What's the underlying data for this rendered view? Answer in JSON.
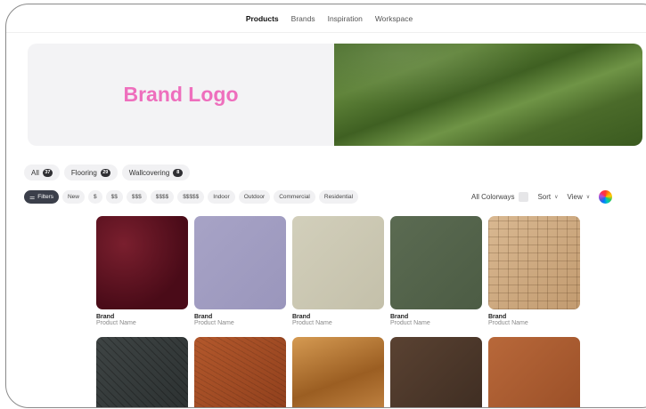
{
  "nav": {
    "items": [
      {
        "label": "Products",
        "active": true
      },
      {
        "label": "Brands",
        "active": false
      },
      {
        "label": "Inspiration",
        "active": false
      },
      {
        "label": "Workspace",
        "active": false
      }
    ]
  },
  "hero": {
    "logo_text": "Brand Logo",
    "logo_color": "#ee6fbd",
    "image_color": "#4f7330"
  },
  "categories": [
    {
      "label": "All",
      "count": "37"
    },
    {
      "label": "Flooring",
      "count": "29"
    },
    {
      "label": "Wallcovering",
      "count": "8"
    }
  ],
  "filters": {
    "filters_label": "Filters",
    "chips": [
      "New",
      "$",
      "$$",
      "$$$",
      "$$$$",
      "$$$$$",
      "Indoor",
      "Outdoor",
      "Commercial",
      "Residential"
    ]
  },
  "controls": {
    "colorways_label": "All Colorways",
    "sort_label": "Sort",
    "view_label": "View"
  },
  "products": [
    {
      "brand": "Brand",
      "name": "Product Name",
      "color": "#5a1220"
    },
    {
      "brand": "Brand",
      "name": "Product Name",
      "color": "#a19dc1"
    },
    {
      "brand": "Brand",
      "name": "Product Name",
      "color": "#cbc7b2"
    },
    {
      "brand": "Brand",
      "name": "Product Name",
      "color": "#56654c"
    },
    {
      "brand": "Brand",
      "name": "Product Name",
      "color": "#cfab80"
    },
    {
      "brand": "",
      "name": "",
      "color": "#353b3b"
    },
    {
      "brand": "",
      "name": "",
      "color": "#a34c24"
    },
    {
      "brand": "",
      "name": "",
      "color": "#b97a3a"
    },
    {
      "brand": "",
      "name": "",
      "color": "#4b382b"
    },
    {
      "brand": "",
      "name": "",
      "color": "#a85c30"
    }
  ]
}
